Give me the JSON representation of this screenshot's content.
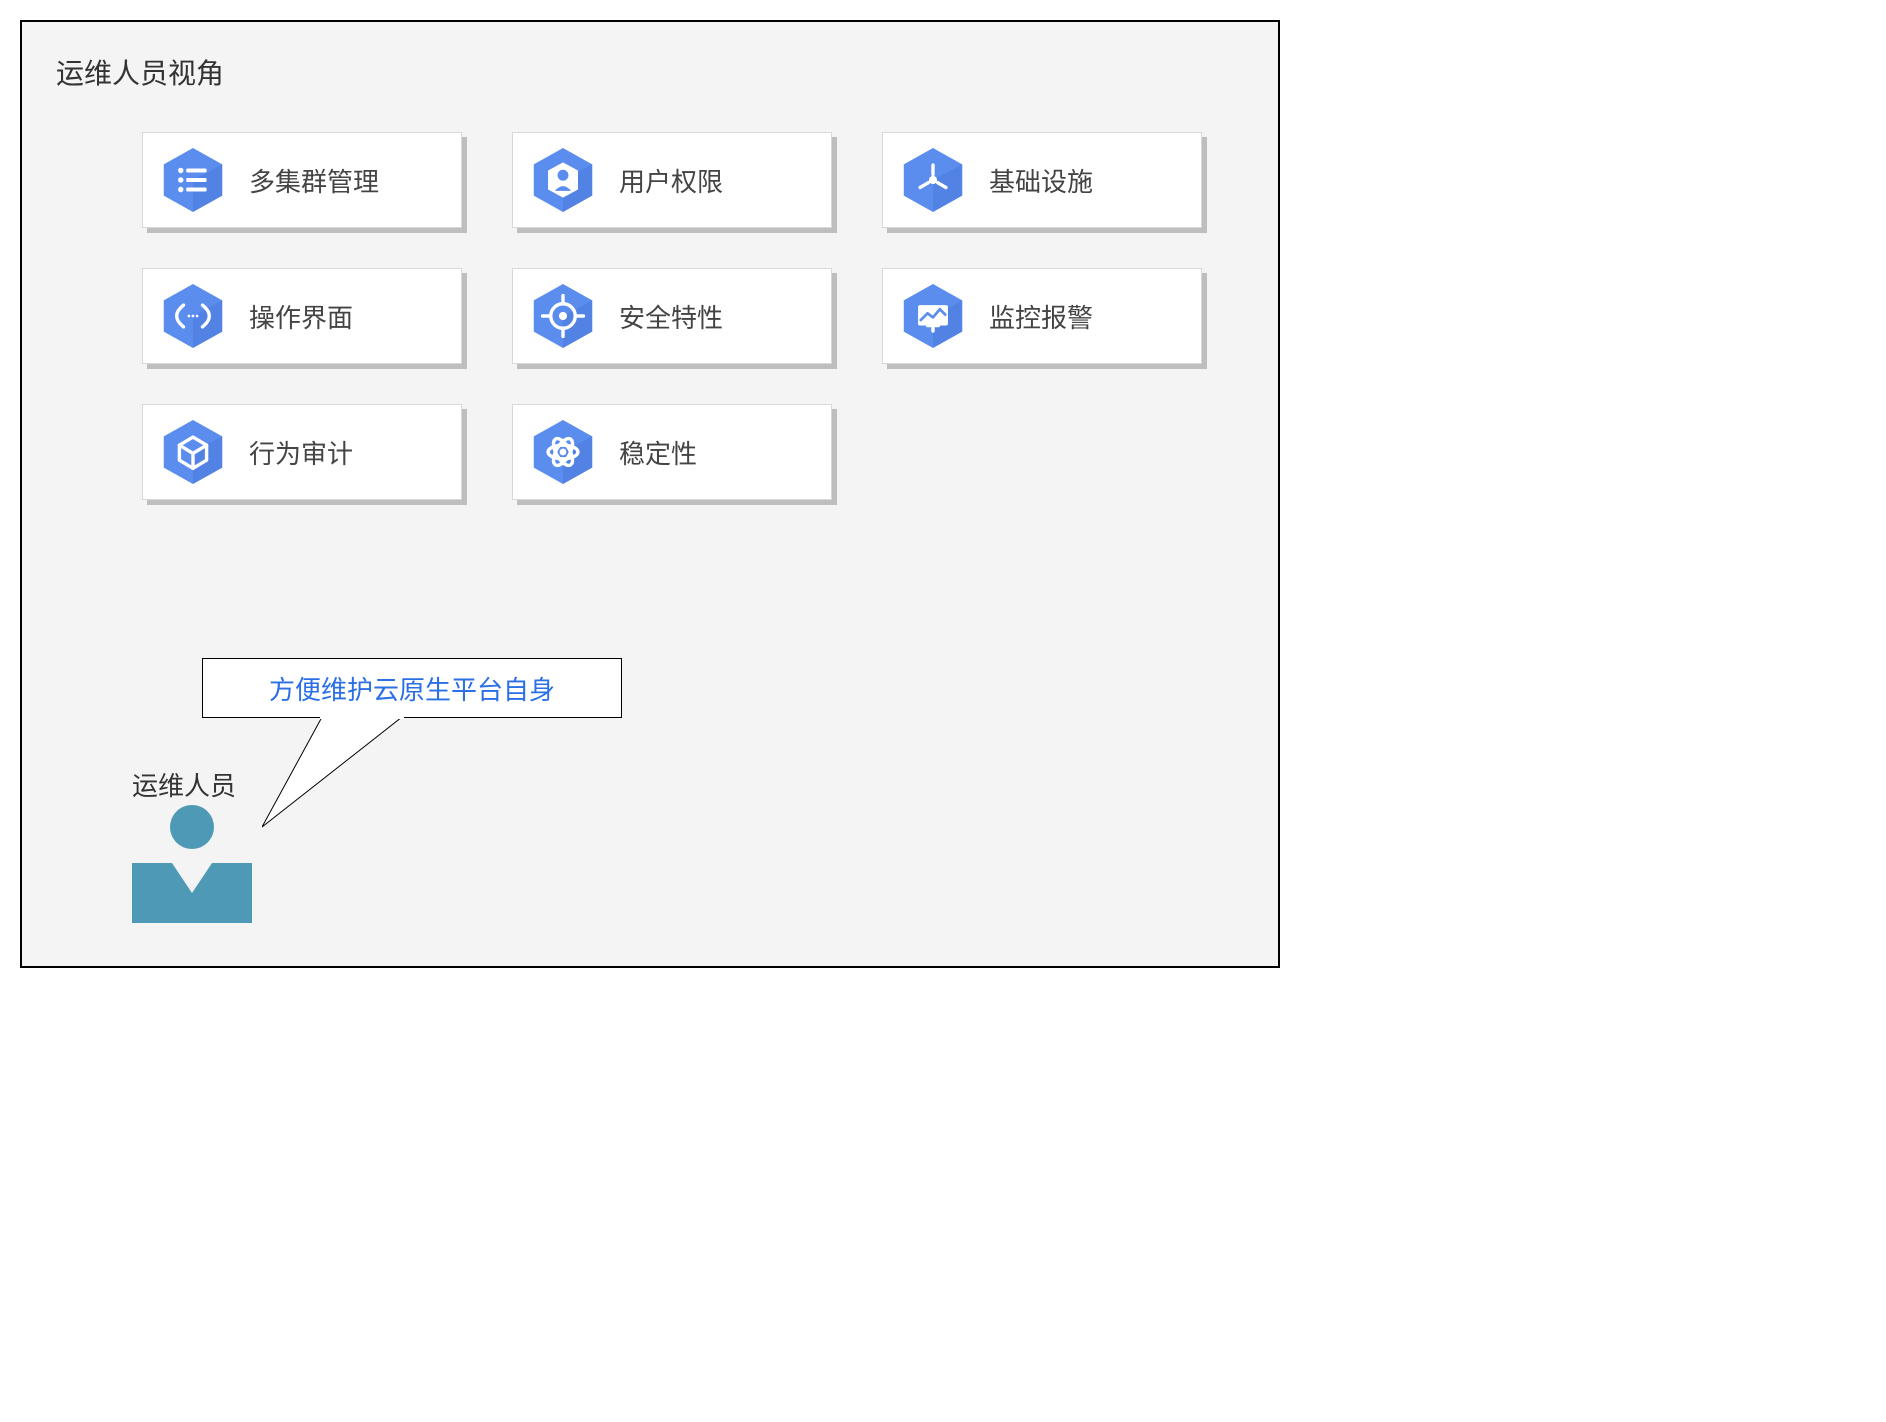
{
  "title": "运维人员视角",
  "colors": {
    "hex_fill": "#5b8def",
    "hex_shadow": "#3f6fd0",
    "icon": "#ffffff",
    "actor": "#4e9ab6",
    "link": "#2a6fe6"
  },
  "cards": [
    {
      "icon": "list",
      "label": "多集群管理"
    },
    {
      "icon": "user",
      "label": "用户权限"
    },
    {
      "icon": "wrench",
      "label": "基础设施"
    },
    {
      "icon": "braces",
      "label": "操作界面"
    },
    {
      "icon": "target",
      "label": "安全特性"
    },
    {
      "icon": "chart",
      "label": "监控报警"
    },
    {
      "icon": "cube",
      "label": "行为审计"
    },
    {
      "icon": "atom",
      "label": "稳定性"
    }
  ],
  "actor": {
    "label": "运维人员",
    "speech": "方便维护云原生平台自身"
  }
}
